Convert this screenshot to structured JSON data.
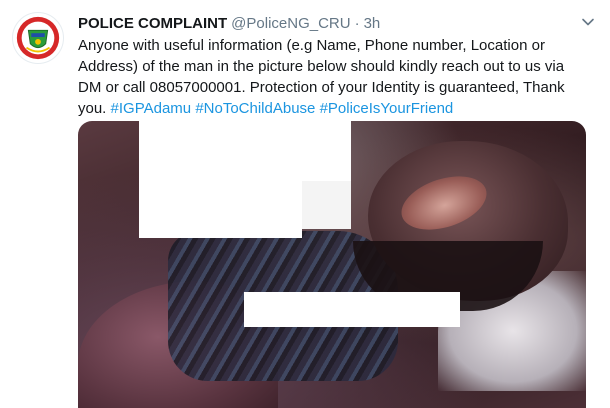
{
  "tweet": {
    "author_name": "POLICE COMPLAINT",
    "handle": "@PoliceNG_CRU",
    "separator": "·",
    "time": "3h",
    "avatar_icon": "police-crest-icon",
    "more_icon": "chevron-down-icon",
    "text_parts": [
      {
        "type": "text",
        "value": "Anyone with useful information (e.g Name, Phone number, Location or Address) of the man in the picture below should kindly reach out to us via DM or call 08057000001. Protection of your Identity is guaranteed, Thank you. "
      },
      {
        "type": "hashtag",
        "value": "#IGPAdamu"
      },
      {
        "type": "text",
        "value": "  "
      },
      {
        "type": "hashtag",
        "value": "#NoToChildAbuse"
      },
      {
        "type": "text",
        "value": " "
      },
      {
        "type": "hashtag",
        "value": "#PoliceIsYourFriend"
      }
    ],
    "hashtag_color": "#1b95e0",
    "muted_color": "#657786",
    "avatar_ring_color": "#d62828"
  }
}
